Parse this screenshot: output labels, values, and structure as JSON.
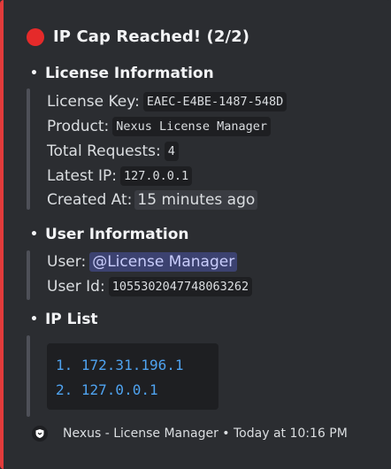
{
  "embed": {
    "accent_color": "#e23b3b",
    "status_icon": "red-circle-icon",
    "title": "IP Cap Reached! (2/2)"
  },
  "license_info": {
    "heading": "License Information",
    "license_key_label": "License Key:",
    "license_key_value": "EAEC-E4BE-1487-548D",
    "product_label": "Product:",
    "product_value": "Nexus License Manager",
    "total_requests_label": "Total Requests:",
    "total_requests_value": "4",
    "latest_ip_label": "Latest IP:",
    "latest_ip_value": "127.0.0.1",
    "created_at_label": "Created At:",
    "created_at_value": "15 minutes ago"
  },
  "user_info": {
    "heading": "User Information",
    "user_label": "User:",
    "user_mention": "@License Manager",
    "user_id_label": "User Id:",
    "user_id_value": "1055302047748063262"
  },
  "ip_list": {
    "heading": "IP List",
    "items": [
      "1. 172.31.196.1",
      "2. 127.0.0.1"
    ]
  },
  "footer": {
    "icon": "shield-icon",
    "text": "Nexus - License Manager • Today at 10:16 PM"
  }
}
